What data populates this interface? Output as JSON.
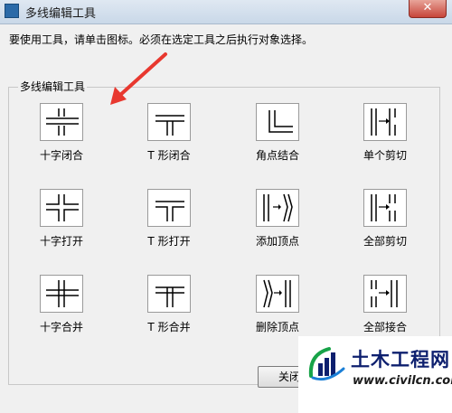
{
  "window": {
    "title": "多线编辑工具",
    "close_glyph": "✕"
  },
  "instruction": "要使用工具，请单击图标。必须在选定工具之后执行对象选择。",
  "group": {
    "label": "多线编辑工具"
  },
  "tools": [
    {
      "label": "十字闭合",
      "icon": "cross-closed-icon"
    },
    {
      "label": "T 形闭合",
      "icon": "tee-closed-icon"
    },
    {
      "label": "角点结合",
      "icon": "corner-joint-icon"
    },
    {
      "label": "单个剪切",
      "icon": "cut-single-icon"
    },
    {
      "label": "十字打开",
      "icon": "cross-open-icon"
    },
    {
      "label": "T 形打开",
      "icon": "tee-open-icon"
    },
    {
      "label": "添加顶点",
      "icon": "add-vertex-icon"
    },
    {
      "label": "全部剪切",
      "icon": "cut-all-icon"
    },
    {
      "label": "十字合并",
      "icon": "cross-merged-icon"
    },
    {
      "label": "T 形合并",
      "icon": "tee-merged-icon"
    },
    {
      "label": "删除顶点",
      "icon": "delete-vertex-icon"
    },
    {
      "label": "全部接合",
      "icon": "weld-all-icon"
    }
  ],
  "close_button": "关闭",
  "watermark": {
    "title": "土木工程网",
    "url": "www.civilcn.com"
  },
  "colors": {
    "accent_arrow": "#e8382f",
    "watermark_text": "#0d1f6e"
  }
}
